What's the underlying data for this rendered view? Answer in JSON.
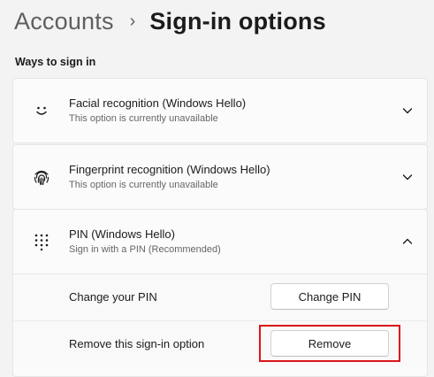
{
  "breadcrumb": {
    "parent": "Accounts",
    "separator": "›",
    "current": "Sign-in options"
  },
  "section_title": "Ways to sign in",
  "options": [
    {
      "icon": "smiley-face-icon",
      "title": "Facial recognition (Windows Hello)",
      "subtitle": "This option is currently unavailable",
      "expanded": false
    },
    {
      "icon": "fingerprint-icon",
      "title": "Fingerprint recognition (Windows Hello)",
      "subtitle": "This option is currently unavailable",
      "expanded": false
    },
    {
      "icon": "pin-keypad-icon",
      "title": "PIN (Windows Hello)",
      "subtitle": "Sign in with a PIN (Recommended)",
      "expanded": true,
      "settings": [
        {
          "label": "Change your PIN",
          "button": "Change PIN"
        },
        {
          "label": "Remove this sign-in option",
          "button": "Remove"
        }
      ]
    }
  ],
  "colors": {
    "background": "#f3f3f3",
    "card": "#fbfbfb",
    "highlight": "#d9151b"
  }
}
